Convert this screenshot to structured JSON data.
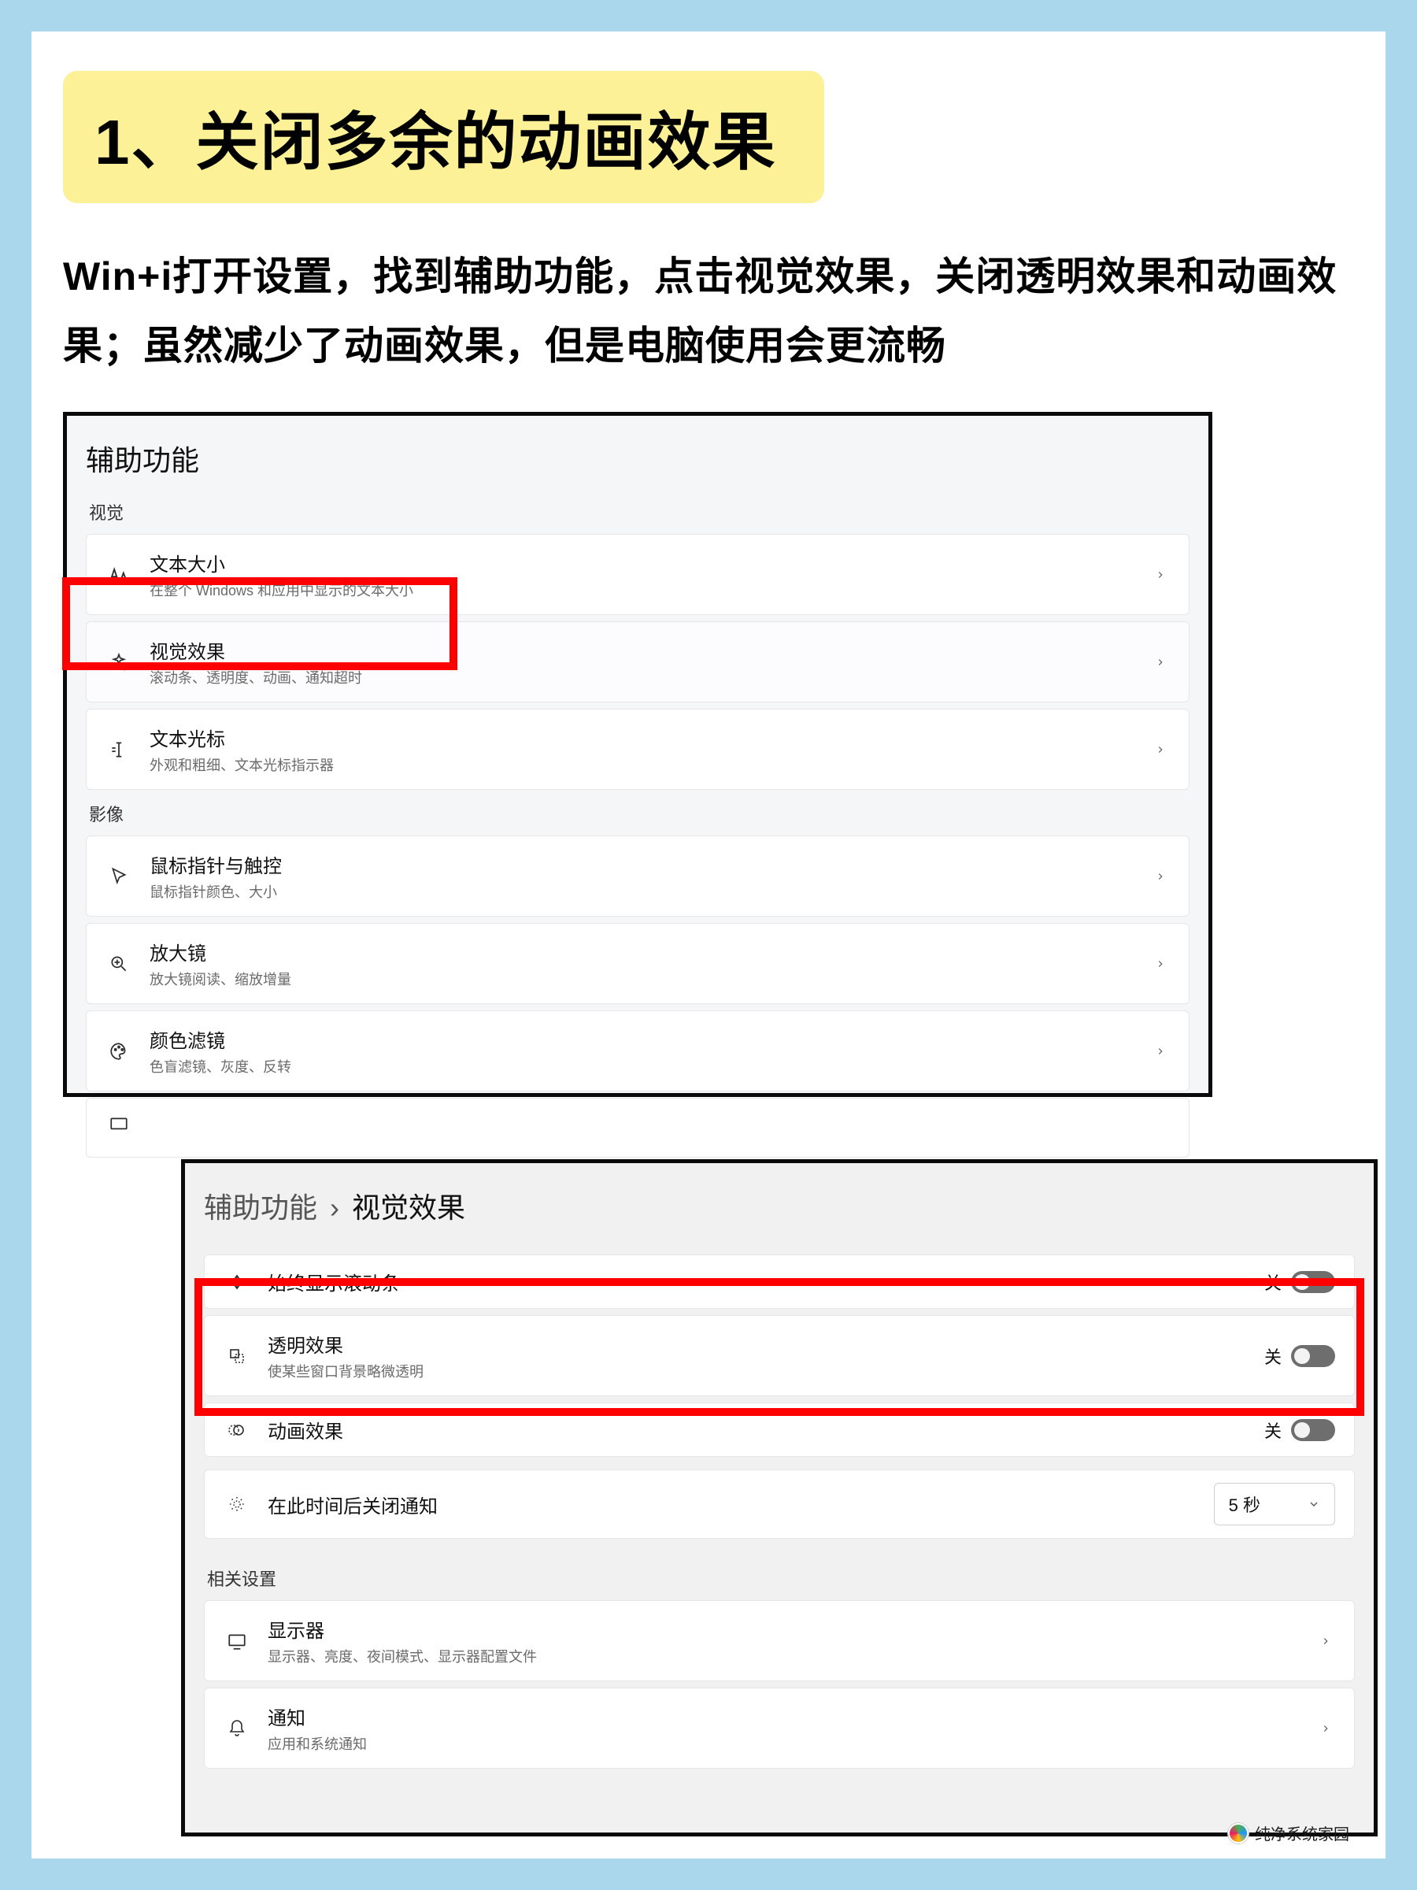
{
  "title": "1、关闭多余的动画效果",
  "description": "Win+i打开设置，找到辅助功能，点击视觉效果，关闭透明效果和动画效果；虽然减少了动画效果，但是电脑使用会更流畅",
  "panel1": {
    "title": "辅助功能",
    "section_vision": "视觉",
    "section_image": "影像",
    "rows": {
      "text_size": {
        "title": "文本大小",
        "sub": "在整个 Windows 和应用中显示的文本大小"
      },
      "visual_effects": {
        "title": "视觉效果",
        "sub": "滚动条、透明度、动画、通知超时"
      },
      "text_cursor": {
        "title": "文本光标",
        "sub": "外观和粗细、文本光标指示器"
      },
      "pointer": {
        "title": "鼠标指针与触控",
        "sub": "鼠标指针颜色、大小"
      },
      "magnifier": {
        "title": "放大镜",
        "sub": "放大镜阅读、缩放增量"
      },
      "color_filter": {
        "title": "颜色滤镜",
        "sub": "色盲滤镜、灰度、反转"
      }
    }
  },
  "panel2": {
    "breadcrumb_parent": "辅助功能",
    "breadcrumb_current": "视觉效果",
    "rows": {
      "scrollbar": {
        "title": "始终显示滚动条",
        "state": "关"
      },
      "transparency": {
        "title": "透明效果",
        "sub": "使某些窗口背景略微透明",
        "state": "关"
      },
      "animation": {
        "title": "动画效果",
        "state": "关"
      },
      "dismiss_notif": {
        "title": "在此时间后关闭通知",
        "value": "5 秒"
      }
    },
    "related_title": "相关设置",
    "related": {
      "display": {
        "title": "显示器",
        "sub": "显示器、亮度、夜间模式、显示器配置文件"
      },
      "notifications": {
        "title": "通知",
        "sub": "应用和系统通知"
      }
    }
  },
  "watermark": "纯净系统家园"
}
